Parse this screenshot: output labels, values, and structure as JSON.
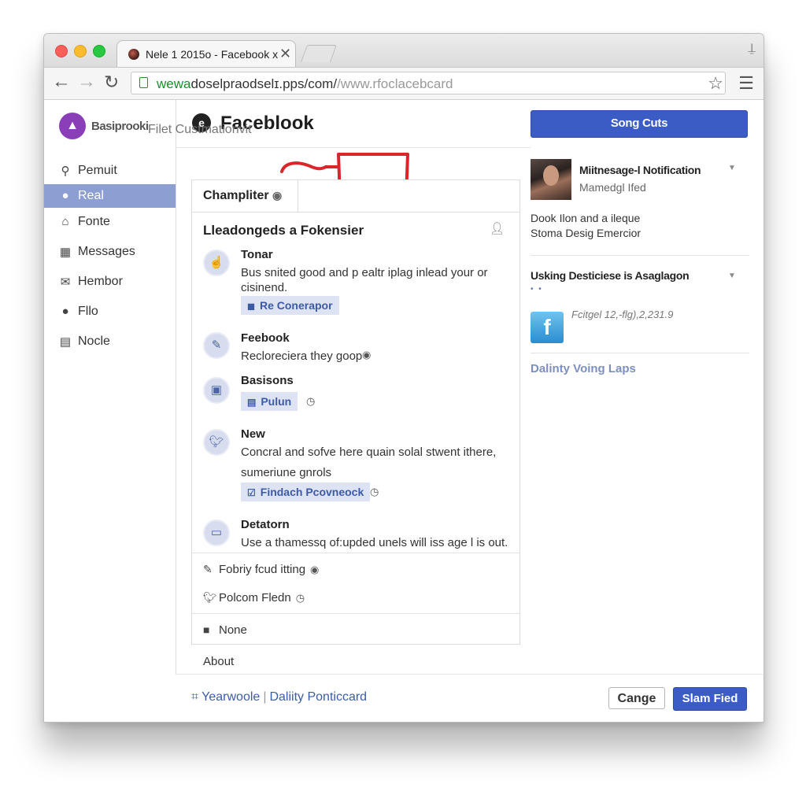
{
  "browser": {
    "tab_title": "Nele 1 2015o - Facebook x",
    "tab_close": "✕",
    "url_prefix": "wewa",
    "url_main": "doselpraodselɪ.pps/com/",
    "url_suffix": "/www.rfoclacebcard"
  },
  "sidebar": {
    "brand_name": "Basiprooki",
    "items": [
      {
        "label": "Pemuit",
        "icon": "search-icon",
        "glyph": "🔍︎"
      },
      {
        "label": "Real",
        "icon": "location-icon",
        "glyph": "⬤"
      },
      {
        "label": "Fonte",
        "icon": "camera-icon",
        "glyph": "⌂"
      },
      {
        "label": "Messages",
        "icon": "messages-icon",
        "glyph": "▦"
      },
      {
        "label": "Hembor",
        "icon": "mail-icon",
        "glyph": "✉"
      },
      {
        "label": "Fllo",
        "icon": "person-icon",
        "glyph": "●"
      },
      {
        "label": "Nocle",
        "icon": "grid-icon",
        "glyph": "▤"
      }
    ]
  },
  "header": {
    "title": "Faceblook",
    "action_button": "Song Cuts"
  },
  "main": {
    "filter_label": "Filet Custmationvit",
    "tab_label": "Champliter",
    "heading": "Lleadongeds a Fokensier",
    "items": [
      {
        "title": "Tonar",
        "text": "Bus snited good and p ealtr iplag inlead your or cisinend.",
        "chip": "Re Conerapor",
        "icon": "hand-icon"
      },
      {
        "title": "Feebook",
        "text": "Recloreciera they goop",
        "icon": "chat-icon"
      },
      {
        "title": "Basisons",
        "chip": "Pulun",
        "icon": "image-icon"
      },
      {
        "title": "New",
        "text": "Concral and sofve here quain solal stwent ithere,",
        "text2": "sumeriune gnrols",
        "chip": "Findach Pcovneock",
        "icon": "twitter-icon"
      },
      {
        "title": "Detatorn",
        "text": "Use a thamessq of:upded unels will iss age l is out.",
        "icon": "calendar-icon"
      }
    ],
    "footer_rows": [
      {
        "label": "Fobriy fcud itting",
        "icon": "pencil-icon"
      },
      {
        "label": "Polcom Fledn",
        "icon": "twitter-icon"
      },
      {
        "label": "None",
        "icon": "square-icon"
      }
    ],
    "about": "About"
  },
  "right": {
    "notif_title": "Miitnesage-l Notification",
    "notif_sub": "Mamedgl Ifed",
    "notif_line1": "Dook Ilon and a ileque",
    "notif_line2": "Stoma Desig Emercior",
    "section2_title": "Usking Desticiese is Asaglagon",
    "dots": "• •",
    "app_text": "Fcitgel 12,-flg),2,231.9",
    "link": "Dalinty Voing Laps"
  },
  "footer": {
    "left_link1": "Yearwoole",
    "left_sep": "|",
    "left_link2": "Daliity Ponticcard",
    "cancel": "Cange",
    "primary": "Slam Fied"
  },
  "colors": {
    "accent": "#3b5cc4",
    "sidebar_active": "#8d9ed2",
    "annotation": "#d8262b"
  }
}
